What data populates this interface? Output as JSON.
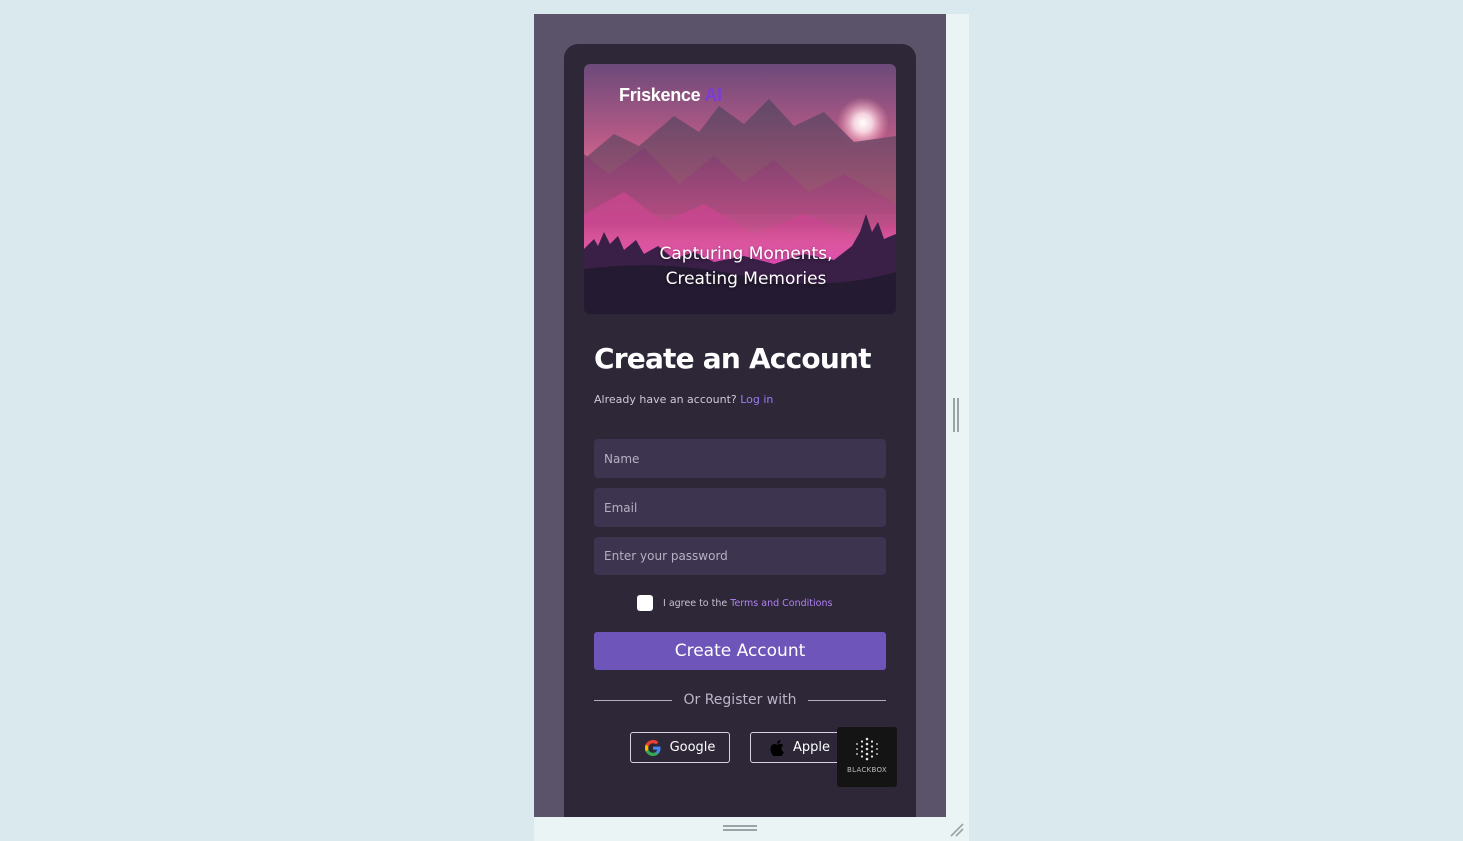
{
  "brand": {
    "name": "Friskence",
    "suffix": "AI"
  },
  "hero": {
    "tagline_line1": "Capturing Moments,",
    "tagline_line2": "Creating Memories"
  },
  "form": {
    "title": "Create an Account",
    "subtitle_prefix": "Already have an account?",
    "login_link": "Log in",
    "name_placeholder": "Name",
    "email_placeholder": "Email",
    "password_placeholder": "Enter your password",
    "terms_prefix": "I agree to the",
    "terms_link": "Terms and Conditions",
    "submit_label": "Create Account",
    "divider_text": "Or Register with",
    "google_label": "Google",
    "apple_label": "Apple"
  },
  "overlay": {
    "blackbox_label": "BLACKBOX"
  },
  "colors": {
    "accent": "#6e55b9",
    "link": "#9a7bf0",
    "card": "#2e2738",
    "field": "#3d3550",
    "page_bg": "#d9e9ed"
  }
}
